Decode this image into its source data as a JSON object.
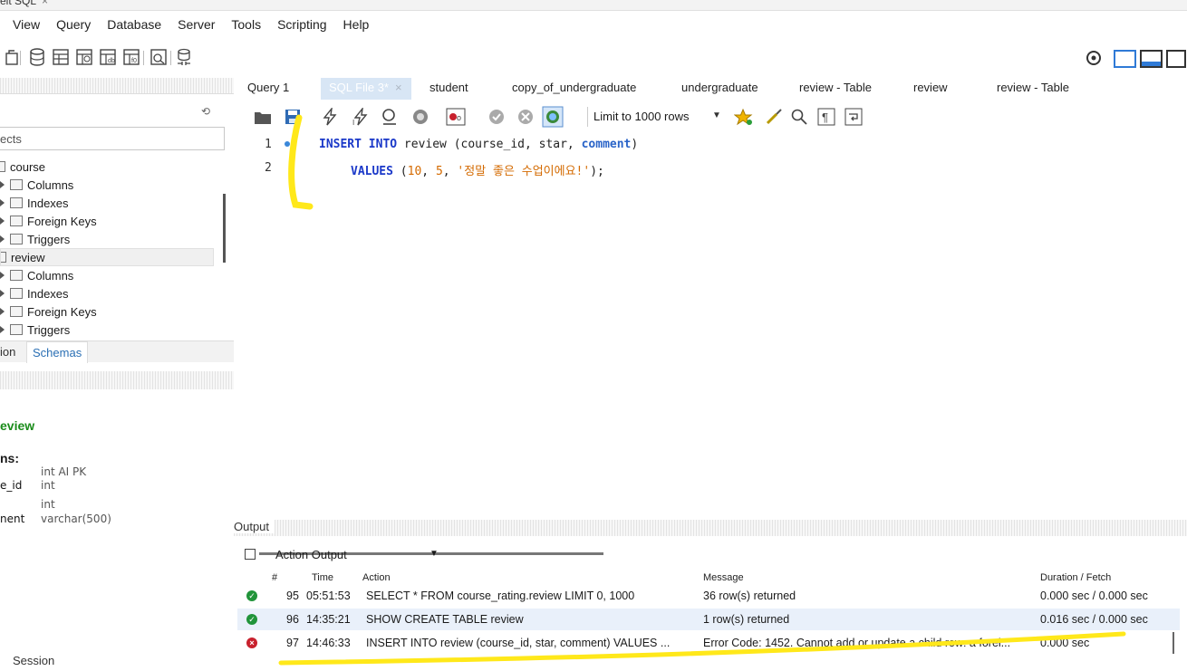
{
  "window": {
    "tab_title": "eit SQL",
    "tab_close": "×"
  },
  "menu": [
    "View",
    "Query",
    "Database",
    "Server",
    "Tools",
    "Scripting",
    "Help"
  ],
  "sidebar": {
    "filter_placeholder": "ects",
    "tree": [
      {
        "label": "course",
        "kind": "table"
      },
      {
        "label": "Columns",
        "kind": "folder"
      },
      {
        "label": "Indexes",
        "kind": "folder"
      },
      {
        "label": "Foreign Keys",
        "kind": "folder"
      },
      {
        "label": "Triggers",
        "kind": "folder"
      },
      {
        "label": "review",
        "kind": "table"
      },
      {
        "label": "Columns",
        "kind": "folder"
      },
      {
        "label": "Indexes",
        "kind": "folder"
      },
      {
        "label": "Foreign Keys",
        "kind": "folder"
      },
      {
        "label": "Triggers",
        "kind": "folder"
      }
    ],
    "tabs": {
      "session": "ion",
      "schemas": "Schemas"
    },
    "info": {
      "title": "eview",
      "columns_label": "ns:",
      "columns": [
        {
          "name": "",
          "type": "int AI PK"
        },
        {
          "name": "e_id",
          "type": "int"
        },
        {
          "name": "",
          "type": "int"
        },
        {
          "name": "nent",
          "type": "varchar(500)"
        }
      ]
    },
    "bottom_tab": "Session"
  },
  "doc_tabs": [
    "Query 1",
    "SQL File 3*",
    "student",
    "copy_of_undergraduate",
    "undergraduate",
    "review - Table",
    "review",
    "review - Table"
  ],
  "editor": {
    "limit": "Limit to 1000 rows",
    "lines": [
      {
        "n": "1"
      },
      {
        "n": "2"
      }
    ],
    "code": {
      "l1_kw": "INSERT INTO",
      "l1_rest": " review (course_id, star, ",
      "l1_fn": "comment",
      "l1_end": ")",
      "l2_kw": "VALUES",
      "l2_open": " (",
      "l2_n1": "10",
      "l2_sep1": ", ",
      "l2_n2": "5",
      "l2_sep2": ", ",
      "l2_str": "'정말 좋은 수업이에요!'",
      "l2_end": ");"
    }
  },
  "output": {
    "label": "Output",
    "selector": "Action Output",
    "headers": {
      "num": "#",
      "time": "Time",
      "action": "Action",
      "message": "Message",
      "duration": "Duration / Fetch"
    },
    "rows": [
      {
        "status": "ok",
        "num": "95",
        "time": "05:51:53",
        "action": "SELECT * FROM course_rating.review LIMIT 0, 1000",
        "message": "36 row(s) returned",
        "duration": "0.000 sec / 0.000 sec"
      },
      {
        "status": "ok",
        "num": "96",
        "time": "14:35:21",
        "action": "SHOW CREATE TABLE review",
        "message": "1 row(s) returned",
        "duration": "0.016 sec / 0.000 sec"
      },
      {
        "status": "error",
        "num": "97",
        "time": "14:46:33",
        "action": "INSERT INTO review (course_id, star, comment) VALUES ...",
        "message": "Error Code: 1452. Cannot add or update a child row: a forei...",
        "duration": "0.000 sec"
      }
    ]
  },
  "colors": {
    "annotation": "#ffe81a",
    "accent": "#2a6fb4",
    "ok": "#21943a",
    "error": "#c8212d"
  }
}
